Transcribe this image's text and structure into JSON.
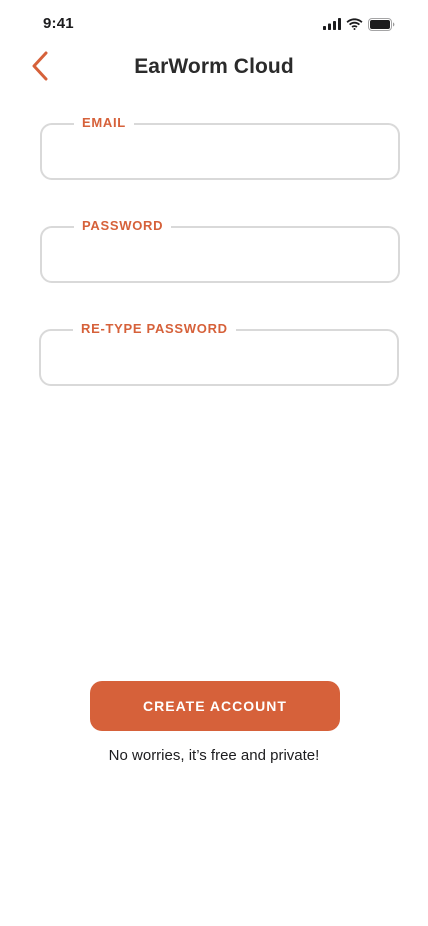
{
  "status_bar": {
    "time": "9:41",
    "icons": [
      "cellular-signal-icon",
      "wifi-icon",
      "battery-icon"
    ]
  },
  "header": {
    "back_icon": "chevron-left-icon",
    "title": "EarWorm Cloud"
  },
  "form": {
    "email": {
      "label": "EMAIL",
      "value": "",
      "placeholder": ""
    },
    "password": {
      "label": "PASSWORD",
      "value": "",
      "placeholder": ""
    },
    "retype_password": {
      "label": "RE-TYPE PASSWORD",
      "value": "",
      "placeholder": ""
    }
  },
  "actions": {
    "create_account_label": "CREATE ACCOUNT",
    "note": "No worries, it’s free and private!"
  },
  "colors": {
    "accent": "#d6613a",
    "field_border": "#d9d9d9",
    "background": "#ffffff",
    "text": "#1c1c1e"
  }
}
